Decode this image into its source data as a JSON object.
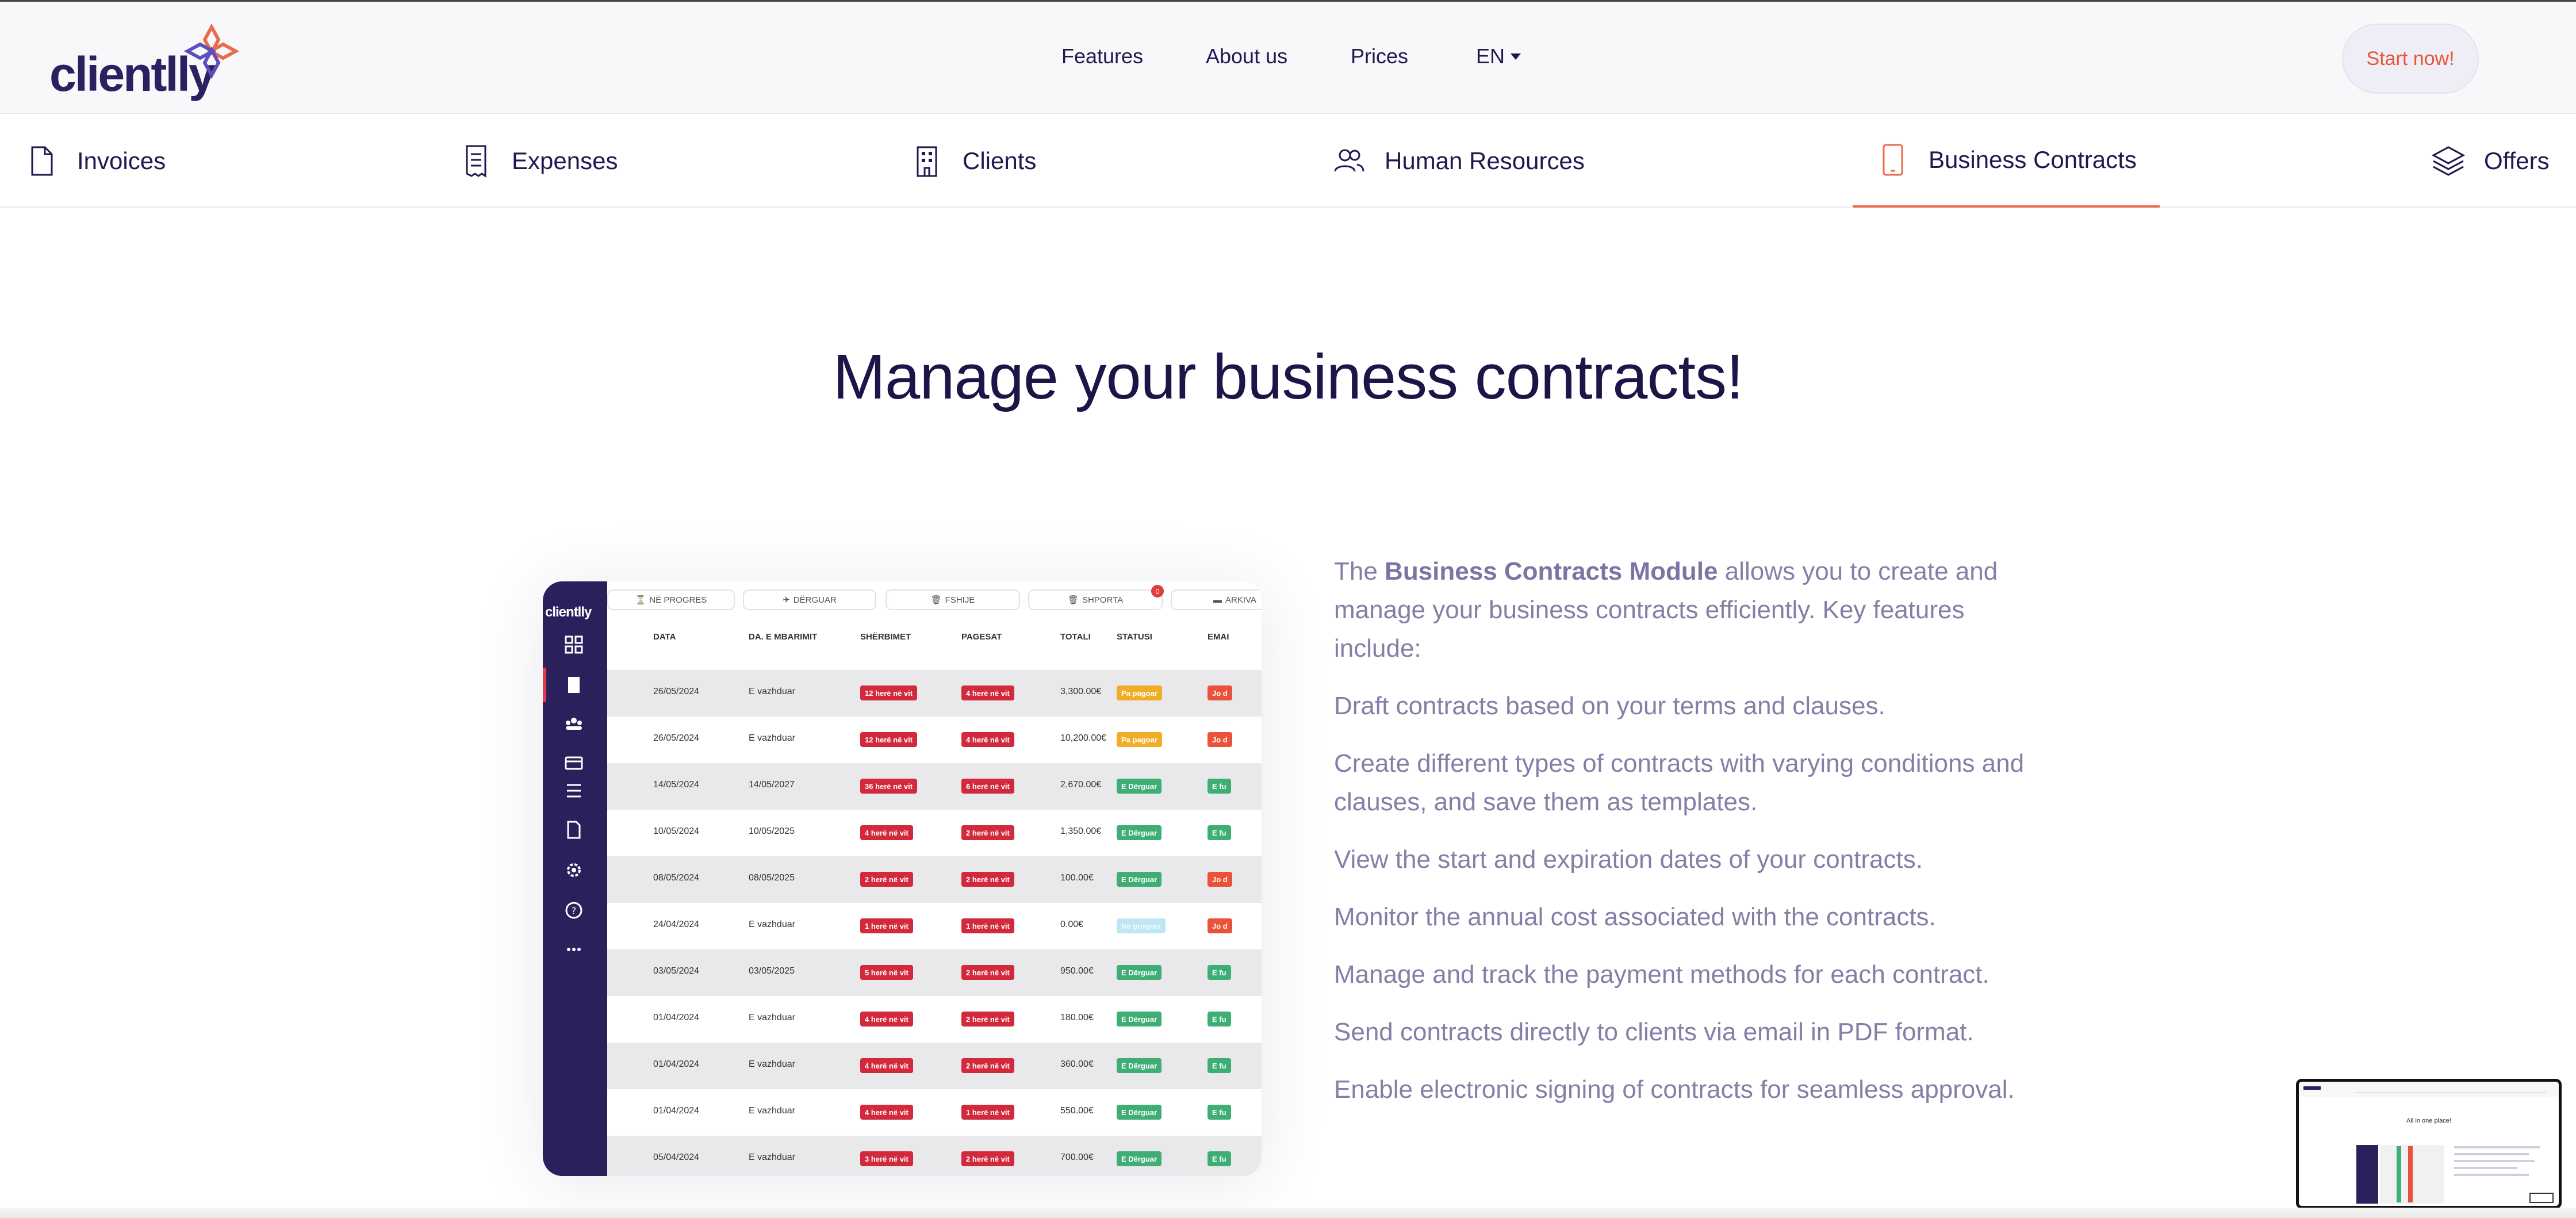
{
  "header": {
    "logo_text": "clientlly",
    "nav": {
      "features": "Features",
      "about": "About us",
      "prices": "Prices",
      "language": "EN"
    },
    "cta": "Start now!"
  },
  "tabs": [
    {
      "label": "Invoices",
      "icon": "document-icon"
    },
    {
      "label": "Expenses",
      "icon": "receipt-icon"
    },
    {
      "label": "Clients",
      "icon": "building-icon"
    },
    {
      "label": "Human Resources",
      "icon": "users-icon"
    },
    {
      "label": "Business Contracts",
      "icon": "tablet-icon",
      "active": true
    },
    {
      "label": "Offers",
      "icon": "layers-icon"
    }
  ],
  "headline": "Manage your business contracts!",
  "screenshot": {
    "logo_text": "clientlly",
    "toolbar": [
      "NË PROGRES",
      "DËRGUAR",
      "FSHIJE",
      "SHPORTA",
      "ARKIVA"
    ],
    "cart_badge": "0",
    "columns": [
      "DATA",
      "DA. E MBARIMIT",
      "SHËRBIMET",
      "PAGESAT",
      "TOTALI",
      "STATUSI",
      "EMAI"
    ],
    "rows": [
      {
        "date": "26/05/2024",
        "end": "E vazhduar",
        "services": "12 herë në vit",
        "payments": "4 herë në vit",
        "total": "3,300.00€",
        "status": "Pa pagoar",
        "status_color": "yellow",
        "email": "Jo d",
        "email_color": "orange"
      },
      {
        "date": "26/05/2024",
        "end": "E vazhduar",
        "services": "12 herë në vit",
        "payments": "4 herë në vit",
        "total": "10,200.00€",
        "status": "Pa pagoar",
        "status_color": "yellow",
        "email": "Jo d",
        "email_color": "orange"
      },
      {
        "date": "14/05/2024",
        "end": "14/05/2027",
        "services": "36 herë në vit",
        "payments": "6 herë në vit",
        "total": "2,670.00€",
        "status": "E Dërguar",
        "status_color": "green",
        "email": "E fu",
        "email_color": "green"
      },
      {
        "date": "10/05/2024",
        "end": "10/05/2025",
        "services": "4 herë në vit",
        "payments": "2 herë në vit",
        "total": "1,350.00€",
        "status": "E Dërguar",
        "status_color": "green",
        "email": "E fu",
        "email_color": "green"
      },
      {
        "date": "08/05/2024",
        "end": "08/05/2025",
        "services": "2 herë në vit",
        "payments": "2 herë në vit",
        "total": "100.00€",
        "status": "E Dërguar",
        "status_color": "green",
        "email": "Jo d",
        "email_color": "orange"
      },
      {
        "date": "24/04/2024",
        "end": "E vazhduar",
        "services": "1 herë në vit",
        "payments": "1 herë në vit",
        "total": "0.00€",
        "status": "Në progres",
        "status_color": "lightblue",
        "email": "Jo d",
        "email_color": "orange"
      },
      {
        "date": "03/05/2024",
        "end": "03/05/2025",
        "services": "5 herë në vit",
        "payments": "2 herë në vit",
        "total": "950.00€",
        "status": "E Dërguar",
        "status_color": "green",
        "email": "E fu",
        "email_color": "green"
      },
      {
        "date": "01/04/2024",
        "end": "E vazhduar",
        "services": "4 herë në vit",
        "payments": "2 herë në vit",
        "total": "180.00€",
        "status": "E Dërguar",
        "status_color": "green",
        "email": "E fu",
        "email_color": "green"
      },
      {
        "date": "01/04/2024",
        "end": "E vazhduar",
        "services": "4 herë në vit",
        "payments": "2 herë në vit",
        "total": "360.00€",
        "status": "E Dërguar",
        "status_color": "green",
        "email": "E fu",
        "email_color": "green"
      },
      {
        "date": "01/04/2024",
        "end": "E vazhduar",
        "services": "4 herë në vit",
        "payments": "1 herë në vit",
        "total": "550.00€",
        "status": "E Dërguar",
        "status_color": "green",
        "email": "E fu",
        "email_color": "green"
      },
      {
        "date": "05/04/2024",
        "end": "E vazhduar",
        "services": "3 herë në vit",
        "payments": "2 herë në vit",
        "total": "700.00€",
        "status": "E Dërguar",
        "status_color": "green",
        "email": "E fu",
        "email_color": "green"
      }
    ]
  },
  "description": {
    "intro_prefix": "The ",
    "intro_bold": "Business Contracts Module",
    "intro_suffix": " allows you to create and manage your business contracts efficiently. Key features include:",
    "features": [
      "Draft contracts based on your terms and clauses.",
      "Create different types of contracts with varying conditions and clauses, and save them as templates.",
      "View the start and expiration dates of your contracts.",
      "Monitor the annual cost associated with the contracts.",
      "Manage and track the payment methods for each contract.",
      "Send contracts directly to clients via email in PDF format.",
      "Enable electronic signing of contracts for seamless approval."
    ]
  },
  "video_thumbnail": {
    "title": "All in one place!"
  },
  "colors": {
    "brand": "#2a2260",
    "accent": "#e86d4e",
    "sidebar": "#2b1f5c"
  }
}
